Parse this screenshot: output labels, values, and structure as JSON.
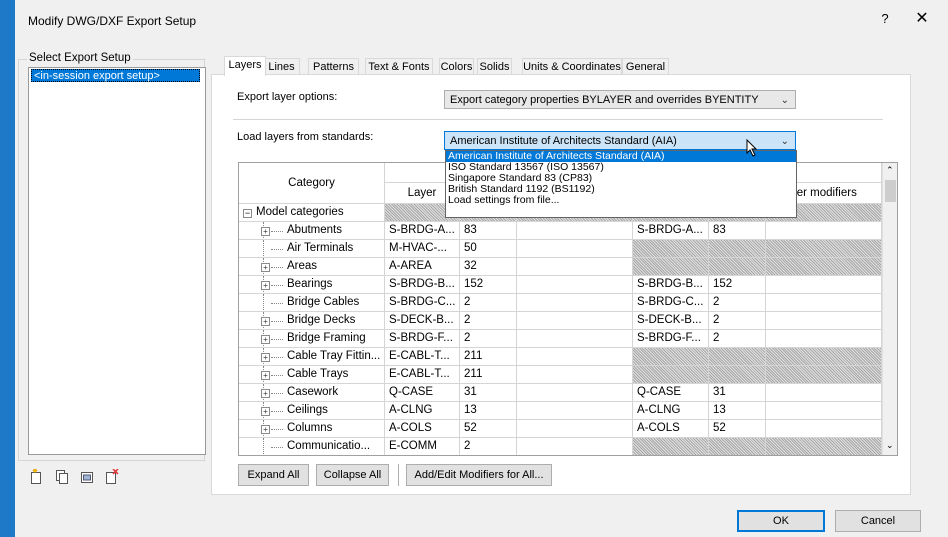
{
  "window": {
    "title": "Modify DWG/DXF Export Setup",
    "help": "?",
    "close": "✕"
  },
  "left": {
    "group_label": "Select Export Setup",
    "items": [
      "<in-session export setup>"
    ]
  },
  "tabs": [
    {
      "label": "Layers",
      "active": true
    },
    {
      "label": "Lines"
    },
    {
      "label": "Patterns"
    },
    {
      "label": "Text & Fonts"
    },
    {
      "label": "Colors"
    },
    {
      "label": "Solids"
    },
    {
      "label": "Units & Coordinates"
    },
    {
      "label": "General"
    }
  ],
  "layers": {
    "export_label": "Export layer options:",
    "export_value": "Export category properties BYLAYER and overrides BYENTITY",
    "load_label": "Load layers from standards:",
    "load_value": "American Institute of Architects Standard (AIA)",
    "dropdown": [
      "American Institute of Architects Standard (AIA)",
      "ISO Standard 13567 (ISO 13567)",
      "Singapore Standard 83 (CP83)",
      "British Standard 1192 (BS1192)",
      "Load settings from file..."
    ]
  },
  "grid": {
    "headers": {
      "category": "Category",
      "layer": "Layer",
      "layer_modifiers": "yer modifiers"
    },
    "rows": [
      {
        "cat": "Model categories",
        "kind": "root",
        "layer": "",
        "color": "",
        "cut_layer": "",
        "cut_color": "",
        "hatched": true
      },
      {
        "cat": "Abutments",
        "kind": "child",
        "layer": "S-BRDG-A...",
        "color": "83",
        "cut_layer": "S-BRDG-A...",
        "cut_color": "83",
        "hatched": false
      },
      {
        "cat": "Air Terminals",
        "kind": "leaf",
        "layer": "M-HVAC-...",
        "color": "50",
        "cut_layer": "",
        "cut_color": "",
        "hatched": true
      },
      {
        "cat": "Areas",
        "kind": "child",
        "layer": "A-AREA",
        "color": "32",
        "cut_layer": "",
        "cut_color": "",
        "hatched": true
      },
      {
        "cat": "Bearings",
        "kind": "child",
        "layer": "S-BRDG-B...",
        "color": "152",
        "cut_layer": "S-BRDG-B...",
        "cut_color": "152",
        "hatched": false
      },
      {
        "cat": "Bridge Cables",
        "kind": "leaf",
        "layer": "S-BRDG-C...",
        "color": "2",
        "cut_layer": "S-BRDG-C...",
        "cut_color": "2",
        "hatched": false
      },
      {
        "cat": "Bridge Decks",
        "kind": "child",
        "layer": "S-DECK-B...",
        "color": "2",
        "cut_layer": "S-DECK-B...",
        "cut_color": "2",
        "hatched": false
      },
      {
        "cat": "Bridge Framing",
        "kind": "child",
        "layer": "S-BRDG-F...",
        "color": "2",
        "cut_layer": "S-BRDG-F...",
        "cut_color": "2",
        "hatched": false
      },
      {
        "cat": "Cable Tray Fittin...",
        "kind": "child",
        "layer": "E-CABL-T...",
        "color": "211",
        "cut_layer": "",
        "cut_color": "",
        "hatched": true
      },
      {
        "cat": "Cable Trays",
        "kind": "child",
        "layer": "E-CABL-T...",
        "color": "211",
        "cut_layer": "",
        "cut_color": "",
        "hatched": true
      },
      {
        "cat": "Casework",
        "kind": "child",
        "layer": "Q-CASE",
        "color": "31",
        "cut_layer": "Q-CASE",
        "cut_color": "31",
        "hatched": false
      },
      {
        "cat": "Ceilings",
        "kind": "child",
        "layer": "A-CLNG",
        "color": "13",
        "cut_layer": "A-CLNG",
        "cut_color": "13",
        "hatched": false
      },
      {
        "cat": "Columns",
        "kind": "child",
        "layer": "A-COLS",
        "color": "52",
        "cut_layer": "A-COLS",
        "cut_color": "52",
        "hatched": false
      },
      {
        "cat": "Communicatio...",
        "kind": "leaf",
        "layer": "E-COMM",
        "color": "2",
        "cut_layer": "",
        "cut_color": "",
        "hatched": true
      }
    ]
  },
  "buttons": {
    "expand_all": "Expand All",
    "collapse_all": "Collapse All",
    "add_edit": "Add/Edit Modifiers for All...",
    "ok": "OK",
    "cancel": "Cancel"
  },
  "icons": {
    "new_setup": "new-setup-icon",
    "duplicate_setup": "duplicate-setup-icon",
    "rename_setup": "rename-setup-icon",
    "delete_setup": "delete-setup-icon"
  }
}
